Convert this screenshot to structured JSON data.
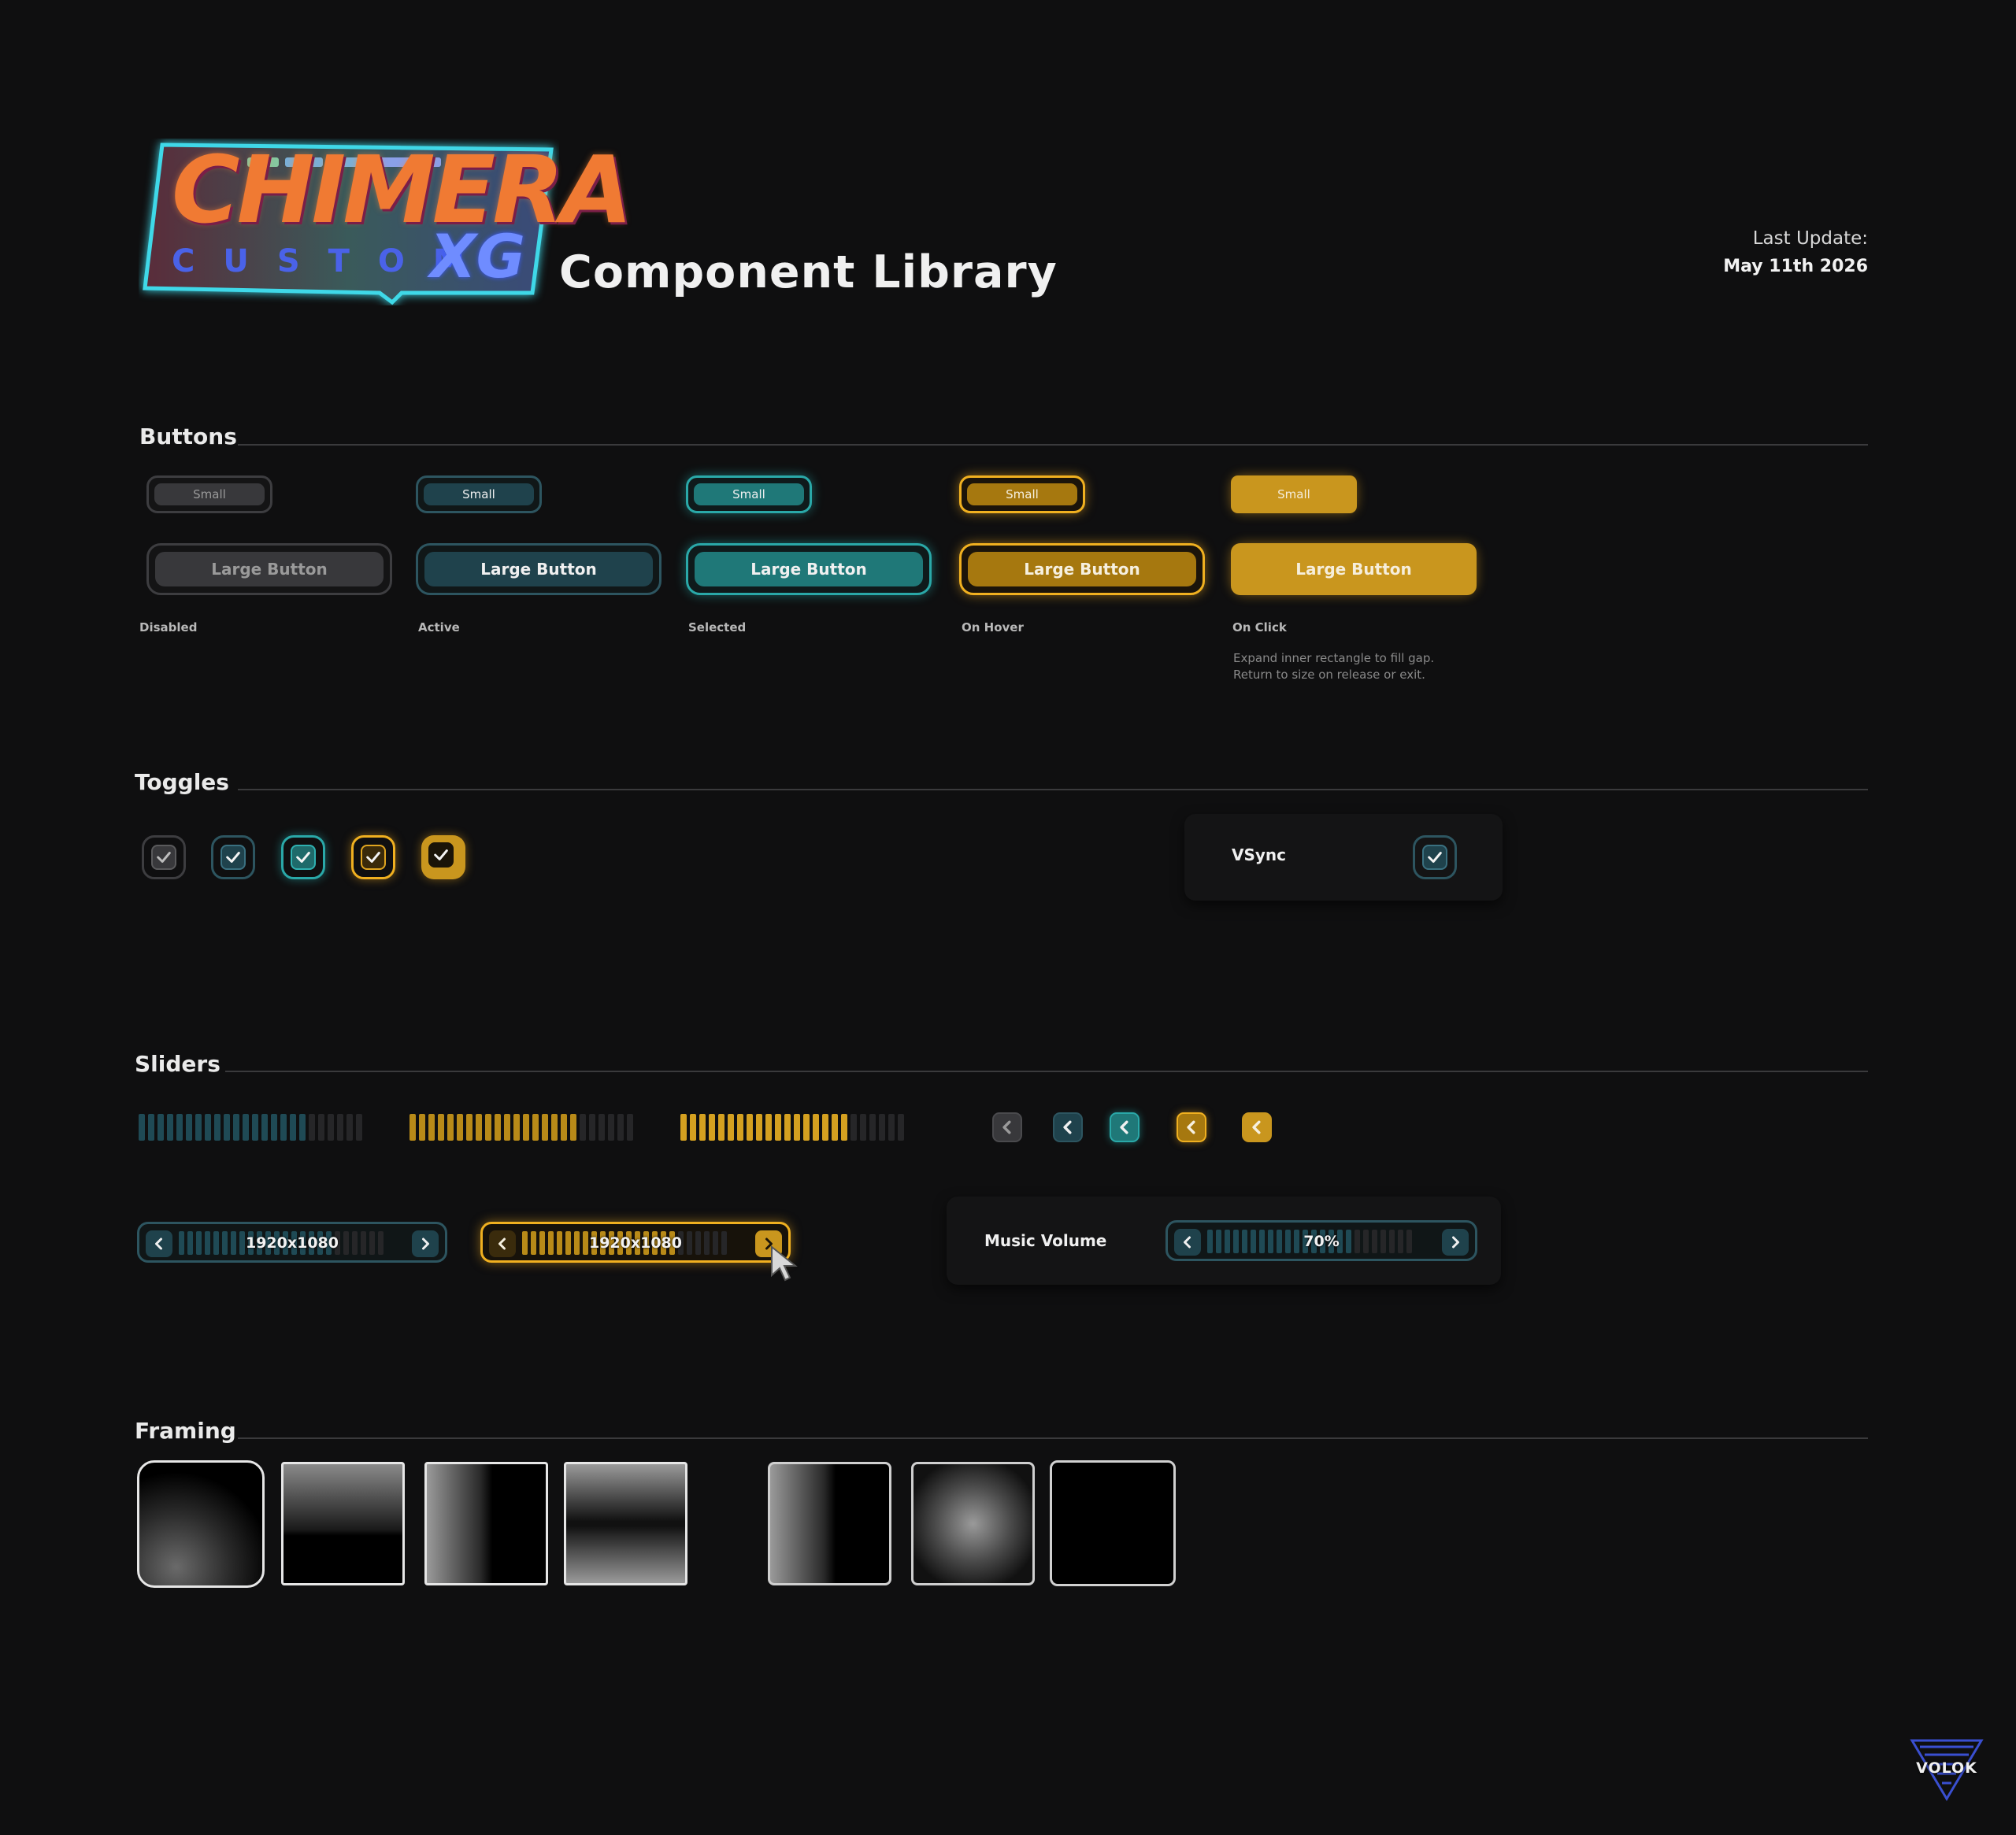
{
  "header": {
    "logo_word": "CHIMERA",
    "logo_sub": "CUSTOM",
    "logo_xg": "XG",
    "title": "Component Library",
    "last_update_label": "Last Update:",
    "last_update_date": "May 11th 2026"
  },
  "sections": {
    "buttons": "Buttons",
    "toggles": "Toggles",
    "sliders": "Sliders",
    "framing": "Framing"
  },
  "buttons": {
    "small_label": "Small",
    "large_label": "Large Button",
    "states": [
      "Disabled",
      "Active",
      "Selected",
      "On Hover",
      "On Click"
    ],
    "on_click_note_1": "Expand inner rectangle to fill gap.",
    "on_click_note_2": "Return to size on release or exit."
  },
  "toggles": {
    "vsync_label": "VSync",
    "vsync_checked": true
  },
  "sliders": {
    "bar_fill_fraction": [
      0.75,
      0.75,
      0.75
    ],
    "resolution_value": "1920x1080",
    "resolution_value_hover": "1920x1080",
    "music_volume_label": "Music Volume",
    "music_volume_value": "70%",
    "music_volume_fraction": 0.7
  },
  "brand": {
    "studio": "VOLOK"
  },
  "colors": {
    "background": "#0f0f10",
    "disabled": "#38383b",
    "active": "#1f424c",
    "selected": "#1f7878",
    "hover": "#a6780f",
    "click": "#c9961e",
    "teal_glow": "#2aa8a8",
    "amber_glow": "#f0b020"
  },
  "icons": {
    "check": "check-icon",
    "chevron_left": "chevron-left-icon",
    "chevron_right": "chevron-right-icon",
    "cursor": "cursor-arrow-icon"
  }
}
